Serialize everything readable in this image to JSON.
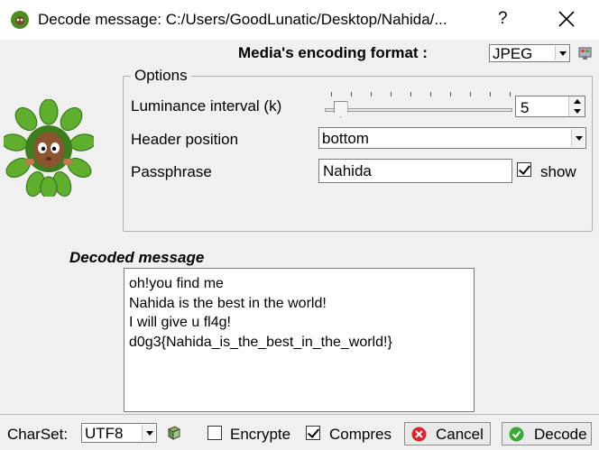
{
  "window": {
    "title": "Decode message: C:/Users/GoodLunatic/Desktop/Nahida/...",
    "help_glyph": "?",
    "close_glyph": "✕"
  },
  "encoding": {
    "label": "Media's encoding format :",
    "value": "JPEG",
    "icon": "format-settings-icon"
  },
  "options": {
    "legend": "Options",
    "luminance_label": "Luminance interval (k)",
    "luminance_value": "5",
    "slider_fraction": 0.05,
    "header_label": "Header position",
    "header_value": "bottom",
    "passphrase_label": "Passphrase",
    "passphrase_value": "Nahida",
    "show_label": "show",
    "show_checked": true
  },
  "decoded": {
    "title": "Decoded message",
    "lines": [
      "oh!you find me",
      "Nahida is the best in the world!",
      "I will give u fl4g!",
      "d0g3{Nahida_is_the_best_in_the_world!}"
    ]
  },
  "footer": {
    "charset_label": "CharSet:",
    "charset_value": "UTF8",
    "charset_icon": "charset-book-icon",
    "encrypted_label": "Encrypte",
    "encrypted_checked": false,
    "compress_label": "Compres",
    "compress_checked": true,
    "cancel_label": "Cancel",
    "decode_label": "Decode"
  },
  "colors": {
    "window_bg": "#f0f0f0",
    "cancel_icon": "#d9262c",
    "decode_icon": "#3aa835",
    "mascot_leaf": "#5fae2e"
  }
}
